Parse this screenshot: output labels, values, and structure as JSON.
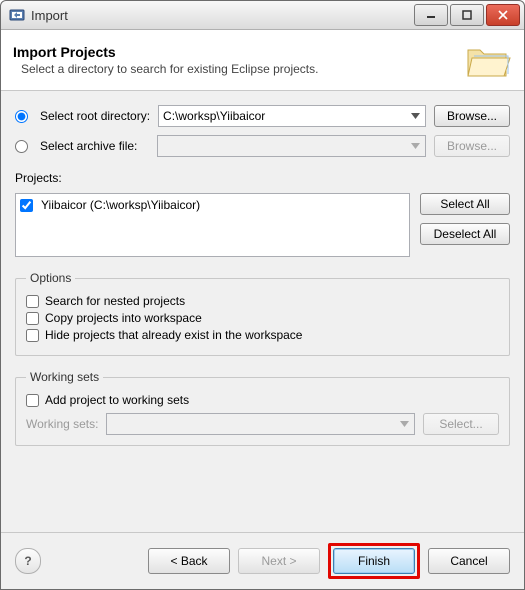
{
  "window": {
    "title": "Import"
  },
  "banner": {
    "heading": "Import Projects",
    "sub": "Select a directory to search for existing Eclipse projects."
  },
  "source": {
    "root_label": "Select root directory:",
    "root_path": "C:\\worksp\\Yiibaicor",
    "archive_label": "Select archive file:",
    "archive_path": "",
    "browse_label": "Browse..."
  },
  "projects": {
    "label": "Projects:",
    "items": [
      {
        "name": "Yiibaicor (C:\\worksp\\Yiibaicor)",
        "checked": true
      }
    ],
    "select_all": "Select All",
    "deselect_all": "Deselect All"
  },
  "options": {
    "legend": "Options",
    "nested": "Search for nested projects",
    "copy": "Copy projects into workspace",
    "hide": "Hide projects that already exist in the workspace"
  },
  "working_sets": {
    "legend": "Working sets",
    "add": "Add project to working sets",
    "label": "Working sets:",
    "select": "Select..."
  },
  "footer": {
    "back": "< Back",
    "next": "Next >",
    "finish": "Finish",
    "cancel": "Cancel"
  }
}
